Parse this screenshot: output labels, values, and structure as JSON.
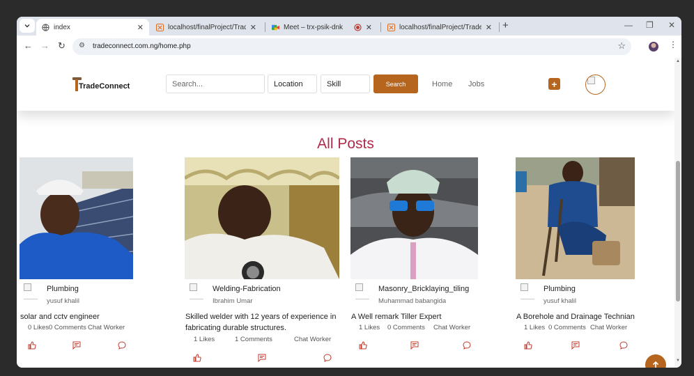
{
  "browser": {
    "tabs": [
      {
        "title": "index",
        "active": true
      },
      {
        "title": "localhost/finalProject/TradeCon",
        "active": false
      },
      {
        "title": "Meet – trx-psik-dnk",
        "active": false
      },
      {
        "title": "localhost/finalProject/TradeCon",
        "active": false
      }
    ],
    "url": "tradeconnect.com.ng/home.php"
  },
  "header": {
    "brand": "TradeConnect",
    "search_placeholder": "Search...",
    "location_label": "Location",
    "skill_label": "Skill",
    "search_button": "Search",
    "nav": [
      "Home",
      "Jobs"
    ],
    "add_button": "+"
  },
  "page_title": "All Posts",
  "posts": [
    {
      "category": "Plumbing",
      "user": "yusuf khalil",
      "description": "solar and cctv engineer",
      "likes": "0 Likes",
      "comments": "0 Comments",
      "chat": "Chat Worker"
    },
    {
      "category": "Welding-Fabrication",
      "user": "Ibrahim Umar",
      "description": "Skilled welder with 12 years of experience in fabricating durable structures.",
      "likes": "1 Likes",
      "comments": "1 Comments",
      "chat": "Chat Worker"
    },
    {
      "category": "Masonry_Bricklaying_tiling",
      "user": "Muhammad babangida",
      "description": "A Well remark Tiller Expert",
      "likes": "1 Likes",
      "comments": "0 Comments",
      "chat": "Chat Worker"
    },
    {
      "category": "Plumbing",
      "user": "yusuf khalil",
      "description": "A Borehole and Drainage Technian",
      "likes": "1 Likes",
      "comments": "0 Comments",
      "chat": "Chat Worker"
    }
  ],
  "colors": {
    "accent": "#b5651d",
    "title": "#b02a4a",
    "icon": "#c0392b"
  }
}
